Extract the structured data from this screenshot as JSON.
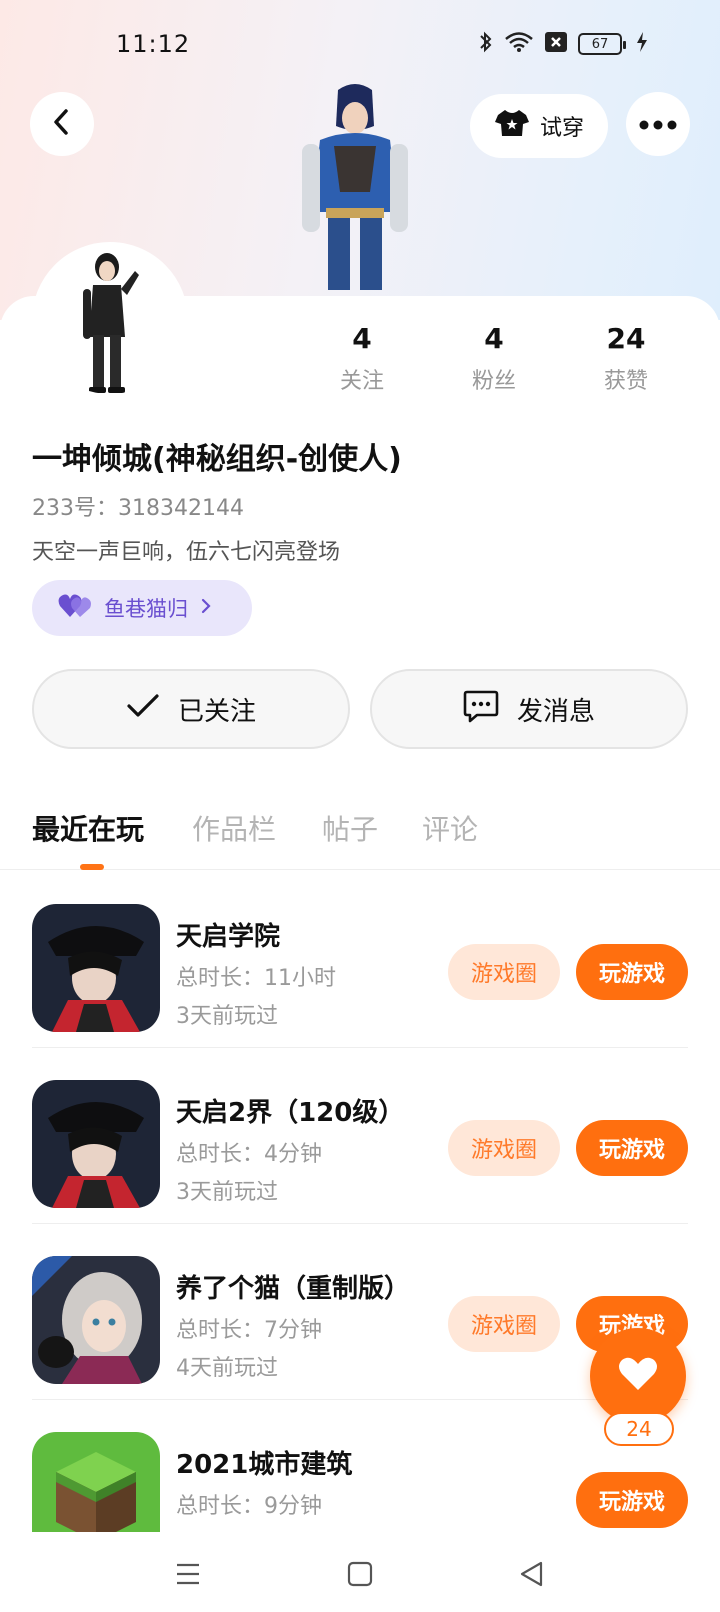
{
  "status": {
    "time": "11:12",
    "battery": "67"
  },
  "header": {
    "try_on_label": "试穿"
  },
  "profile": {
    "stats": [
      {
        "value": "4",
        "label": "关注"
      },
      {
        "value": "4",
        "label": "粉丝"
      },
      {
        "value": "24",
        "label": "获赞"
      }
    ],
    "name": "一坤倾城(神秘组织-创使人)",
    "id_line": "233号：318342144",
    "bio": "天空一声巨响，伍六七闪亮登场",
    "club": "鱼巷猫归"
  },
  "actions": {
    "follow_label": "已关注",
    "message_label": "发消息"
  },
  "tabs": [
    "最近在玩",
    "作品栏",
    "帖子",
    "评论"
  ],
  "games": [
    {
      "title": "天启学院",
      "duration": "总时长：11小时",
      "last": "3天前玩过",
      "circle": "游戏圈",
      "play": "玩游戏"
    },
    {
      "title": "天启2界（120级）",
      "duration": "总时长：4分钟",
      "last": "3天前玩过",
      "circle": "游戏圈",
      "play": "玩游戏"
    },
    {
      "title": "养了个猫（重制版）",
      "duration": "总时长：7分钟",
      "last": "4天前玩过",
      "circle": "游戏圈",
      "play": "玩游戏"
    },
    {
      "title": "2021城市建筑",
      "duration": "总时长：9分钟",
      "last": "",
      "circle": "",
      "play": "玩游戏"
    }
  ],
  "like_fab": {
    "count": "24"
  },
  "colors": {
    "accent": "#ff6f0f",
    "club_bg": "#e9e6fb",
    "club_text": "#6a4fd0"
  },
  "icons": [
    "back-icon",
    "shirt-icon",
    "more-icon",
    "heart-icon",
    "check-icon",
    "chat-icon",
    "menu-icon",
    "home-icon",
    "back-nav-icon"
  ]
}
